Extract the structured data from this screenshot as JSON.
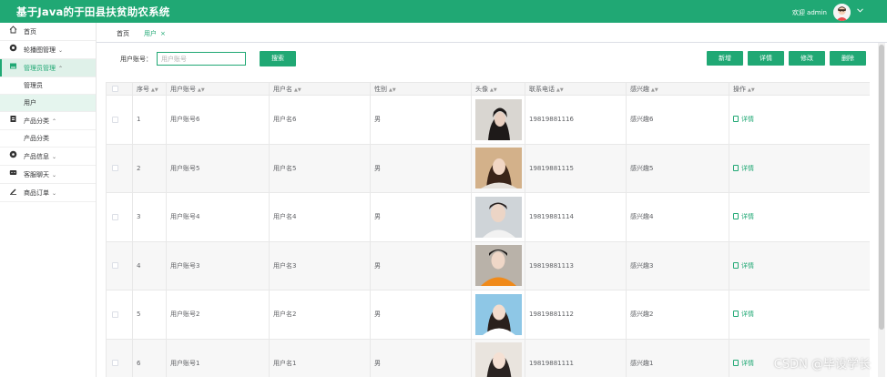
{
  "header": {
    "title": "基于Java的于田县扶贫助农系统",
    "welcome": "欢迎 admin",
    "dropdown_icon": "chevron-down-icon",
    "background": "#20a874"
  },
  "sidebar": {
    "items": [
      {
        "label": "首页",
        "icon": "home-icon"
      },
      {
        "label": "轮播图管理",
        "icon": "carousel-icon"
      },
      {
        "label": "管理员管理",
        "icon": "admin-icon"
      },
      {
        "label": "产品分类",
        "icon": "category-icon"
      },
      {
        "label": "产品信息",
        "icon": "product-icon"
      },
      {
        "label": "客服聊天",
        "icon": "chat-icon"
      },
      {
        "label": "商品订单",
        "icon": "order-icon"
      }
    ],
    "admin_sub": [
      "管理员",
      "用户"
    ],
    "category_sub": [
      "产品分类"
    ]
  },
  "tabs": [
    {
      "label": "首页"
    },
    {
      "label": "用户"
    }
  ],
  "search": {
    "label": "用户账号：",
    "placeholder": "用户账号",
    "button": "搜索"
  },
  "actions": {
    "add": "新增",
    "detail": "详情",
    "edit": "修改",
    "delete": "删除"
  },
  "table": {
    "columns": [
      "序号",
      "用户账号",
      "用户名",
      "性别",
      "头像",
      "联系电话",
      "感兴趣",
      "操作"
    ],
    "rows": [
      {
        "index": "1",
        "account": "用户账号6",
        "username": "用户名6",
        "gender": "男",
        "phone": "19819881116",
        "interest": "感兴趣6",
        "action": "详情"
      },
      {
        "index": "2",
        "account": "用户账号5",
        "username": "用户名5",
        "gender": "男",
        "phone": "19819881115",
        "interest": "感兴趣5",
        "action": "详情"
      },
      {
        "index": "3",
        "account": "用户账号4",
        "username": "用户名4",
        "gender": "男",
        "phone": "19819881114",
        "interest": "感兴趣4",
        "action": "详情"
      },
      {
        "index": "4",
        "account": "用户账号3",
        "username": "用户名3",
        "gender": "男",
        "phone": "19819881113",
        "interest": "感兴趣3",
        "action": "详情"
      },
      {
        "index": "5",
        "account": "用户账号2",
        "username": "用户名2",
        "gender": "男",
        "phone": "19819881112",
        "interest": "感兴趣2",
        "action": "详情"
      },
      {
        "index": "6",
        "account": "用户账号1",
        "username": "用户名1",
        "gender": "男",
        "phone": "19819881111",
        "interest": "感兴趣1",
        "action": "详情"
      }
    ]
  },
  "watermark": "CSDN @毕设学长"
}
